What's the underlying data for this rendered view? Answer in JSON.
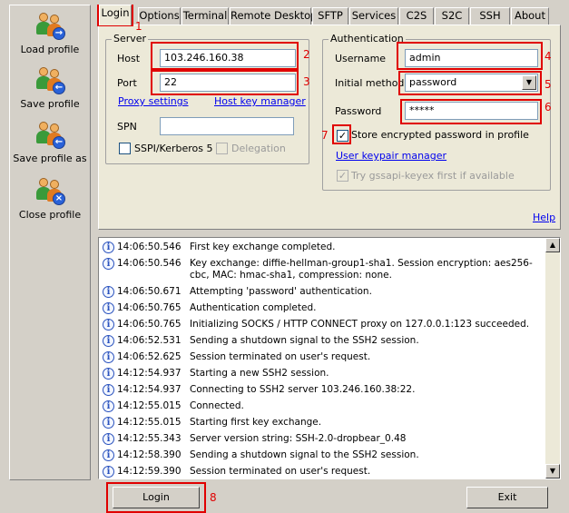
{
  "sidebar": {
    "items": [
      {
        "label": "Load profile",
        "icon": "load-profile-icon"
      },
      {
        "label": "Save profile",
        "icon": "save-profile-icon"
      },
      {
        "label": "Save profile as",
        "icon": "save-profile-as-icon"
      },
      {
        "label": "Close profile",
        "icon": "close-profile-icon"
      }
    ]
  },
  "tabs": [
    "Login",
    "Options",
    "Terminal",
    "Remote Desktop",
    "SFTP",
    "Services",
    "C2S",
    "S2C",
    "SSH",
    "About"
  ],
  "active_tab": "Login",
  "server": {
    "legend": "Server",
    "host_label": "Host",
    "host_value": "103.246.160.38",
    "port_label": "Port",
    "port_value": "22",
    "proxy_link": "Proxy settings",
    "hostkey_link": "Host key manager",
    "spn_label": "SPN",
    "spn_value": "",
    "sspi_label": "SSPI/Kerberos 5",
    "delegation_label": "Delegation"
  },
  "auth": {
    "legend": "Authentication",
    "username_label": "Username",
    "username_value": "admin",
    "method_label": "Initial method",
    "method_value": "password",
    "password_label": "Password",
    "password_value": "*****",
    "store_label": "Store encrypted password in profile",
    "store_checked": true,
    "keypair_link": "User keypair manager",
    "gssapi_label": "Try gssapi-keyex first if available"
  },
  "help_link": "Help",
  "annotations": [
    "1",
    "2",
    "3",
    "4",
    "5",
    "6",
    "7",
    "8"
  ],
  "log": [
    {
      "time": "14:06:50.546",
      "msg": "First key exchange completed."
    },
    {
      "time": "14:06:50.546",
      "msg": "Key exchange: diffie-hellman-group1-sha1. Session encryption: aes256-cbc, MAC: hmac-sha1, compression: none."
    },
    {
      "time": "14:06:50.671",
      "msg": "Attempting 'password' authentication."
    },
    {
      "time": "14:06:50.765",
      "msg": "Authentication completed."
    },
    {
      "time": "14:06:50.765",
      "msg": "Initializing SOCKS / HTTP CONNECT proxy on 127.0.0.1:123 succeeded."
    },
    {
      "time": "14:06:52.531",
      "msg": "Sending a shutdown signal to the SSH2 session."
    },
    {
      "time": "14:06:52.625",
      "msg": "Session terminated on user's request."
    },
    {
      "time": "14:12:54.937",
      "msg": "Starting a new SSH2 session."
    },
    {
      "time": "14:12:54.937",
      "msg": "Connecting to SSH2 server 103.246.160.38:22."
    },
    {
      "time": "14:12:55.015",
      "msg": "Connected."
    },
    {
      "time": "14:12:55.015",
      "msg": "Starting first key exchange."
    },
    {
      "time": "14:12:55.343",
      "msg": "Server version string: SSH-2.0-dropbear_0.48"
    },
    {
      "time": "14:12:58.390",
      "msg": "Sending a shutdown signal to the SSH2 session."
    },
    {
      "time": "14:12:59.390",
      "msg": "Session terminated on user's request."
    }
  ],
  "buttons": {
    "login": "Login",
    "exit": "Exit"
  },
  "colors": {
    "annotation": "#e00000",
    "link": "#0000ee",
    "window": "#d4d0c8",
    "panel": "#ece9d8"
  }
}
